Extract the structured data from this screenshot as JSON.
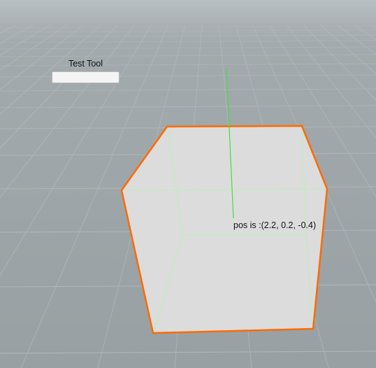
{
  "scene_view": {
    "colors": {
      "sky_top": "#b9c0c4",
      "horizon": "#a7adb0",
      "ground": "#9aa1a4",
      "grid_line": "#b4babd",
      "cube_face": "#dcdcdc",
      "selection_outline": "#ff6a00",
      "handle": "#40e040",
      "inner_edge": "#b8f0b8"
    }
  },
  "tool_panel": {
    "title": "Test Tool",
    "field_value": ""
  },
  "position_label": {
    "text": "pos is :(2.2, 0.2, -0.4)"
  }
}
